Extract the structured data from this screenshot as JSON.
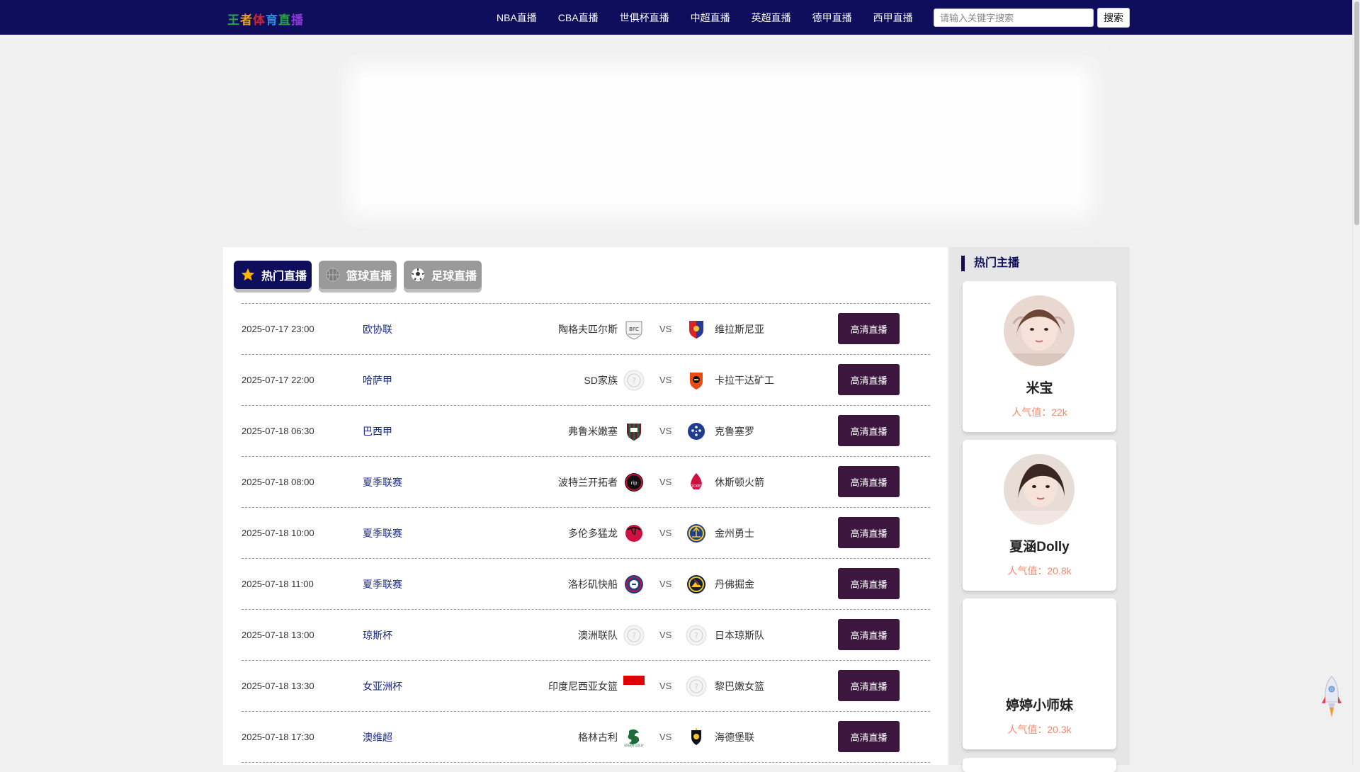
{
  "header": {
    "logo_text": "王者体育直播",
    "logo_colors": [
      "#2aa24a",
      "#e8a21a",
      "#d5262d",
      "#2f8ad5",
      "#2aa24a",
      "#8a3ad1"
    ],
    "nav": [
      {
        "label": "NBA直播"
      },
      {
        "label": "CBA直播"
      },
      {
        "label": "世俱杯直播"
      },
      {
        "label": "中超直播"
      },
      {
        "label": "英超直播"
      },
      {
        "label": "德甲直播"
      },
      {
        "label": "西甲直播"
      }
    ],
    "search": {
      "placeholder": "请输入关键字搜索",
      "button": "搜索"
    }
  },
  "tabs": [
    {
      "label": "热门直播",
      "icon": "star-icon",
      "active": true
    },
    {
      "label": "篮球直播",
      "icon": "basketball-icon",
      "active": false
    },
    {
      "label": "足球直播",
      "icon": "soccer-ball-icon",
      "active": false
    }
  ],
  "matches": [
    {
      "time": "2025-07-17 23:00",
      "league": "欧协联",
      "home": "陶格夫匹尔斯",
      "home_logo": "bfc-shield-icon",
      "vs": "VS",
      "away": "维拉斯尼亚",
      "away_logo": "red-blue-crest-icon",
      "button": "高清直播"
    },
    {
      "time": "2025-07-17 22:00",
      "league": "哈萨甲",
      "home": "SD家族",
      "home_logo": "placeholder-team-icon",
      "vs": "VS",
      "away": "卡拉干达矿工",
      "away_logo": "orange-crest-icon",
      "button": "高清直播"
    },
    {
      "time": "2025-07-18 06:30",
      "league": "巴西甲",
      "home": "弗鲁米嫩塞",
      "home_logo": "fluminense-crest-icon",
      "vs": "VS",
      "away": "克鲁塞罗",
      "away_logo": "cruzeiro-crest-icon",
      "button": "高清直播"
    },
    {
      "time": "2025-07-18 08:00",
      "league": "夏季联赛",
      "home": "波特兰开拓者",
      "home_logo": "blazers-logo-icon",
      "vs": "VS",
      "away": "休斯顿火箭",
      "away_logo": "rockets-logo-icon",
      "button": "高清直播"
    },
    {
      "time": "2025-07-18 10:00",
      "league": "夏季联赛",
      "home": "多伦多猛龙",
      "home_logo": "raptors-logo-icon",
      "vs": "VS",
      "away": "金州勇士",
      "away_logo": "warriors-logo-icon",
      "button": "高清直播"
    },
    {
      "time": "2025-07-18 11:00",
      "league": "夏季联赛",
      "home": "洛杉矶快船",
      "home_logo": "clippers-logo-icon",
      "vs": "VS",
      "away": "丹佛掘金",
      "away_logo": "nuggets-logo-icon",
      "button": "高清直播"
    },
    {
      "time": "2025-07-18 13:00",
      "league": "琼斯杯",
      "home": "澳洲联队",
      "home_logo": "placeholder-team-icon",
      "vs": "VS",
      "away": "日本琼斯队",
      "away_logo": "placeholder-team-icon",
      "button": "高清直播"
    },
    {
      "time": "2025-07-18 13:30",
      "league": "女亚洲杯",
      "home": "印度尼西亚女篮",
      "home_logo": "indonesia-flag-icon",
      "vs": "VS",
      "away": "黎巴嫩女篮",
      "away_logo": "placeholder-team-icon",
      "button": "高清直播"
    },
    {
      "time": "2025-07-18 17:30",
      "league": "澳维超",
      "home": "格林古利",
      "home_logo": "green-gully-crest-icon",
      "vs": "VS",
      "away": "海德堡联",
      "away_logo": "heidelberg-crest-icon",
      "button": "高清直播"
    }
  ],
  "sidebar": {
    "title": "热门主播",
    "anchors": [
      {
        "name": "米宝",
        "popularity": "人气值：22k"
      },
      {
        "name": "夏涵Dolly",
        "popularity": "人气值：20.8k"
      },
      {
        "name": "婷婷小师妹",
        "popularity": "人气值：20.3k"
      }
    ]
  }
}
